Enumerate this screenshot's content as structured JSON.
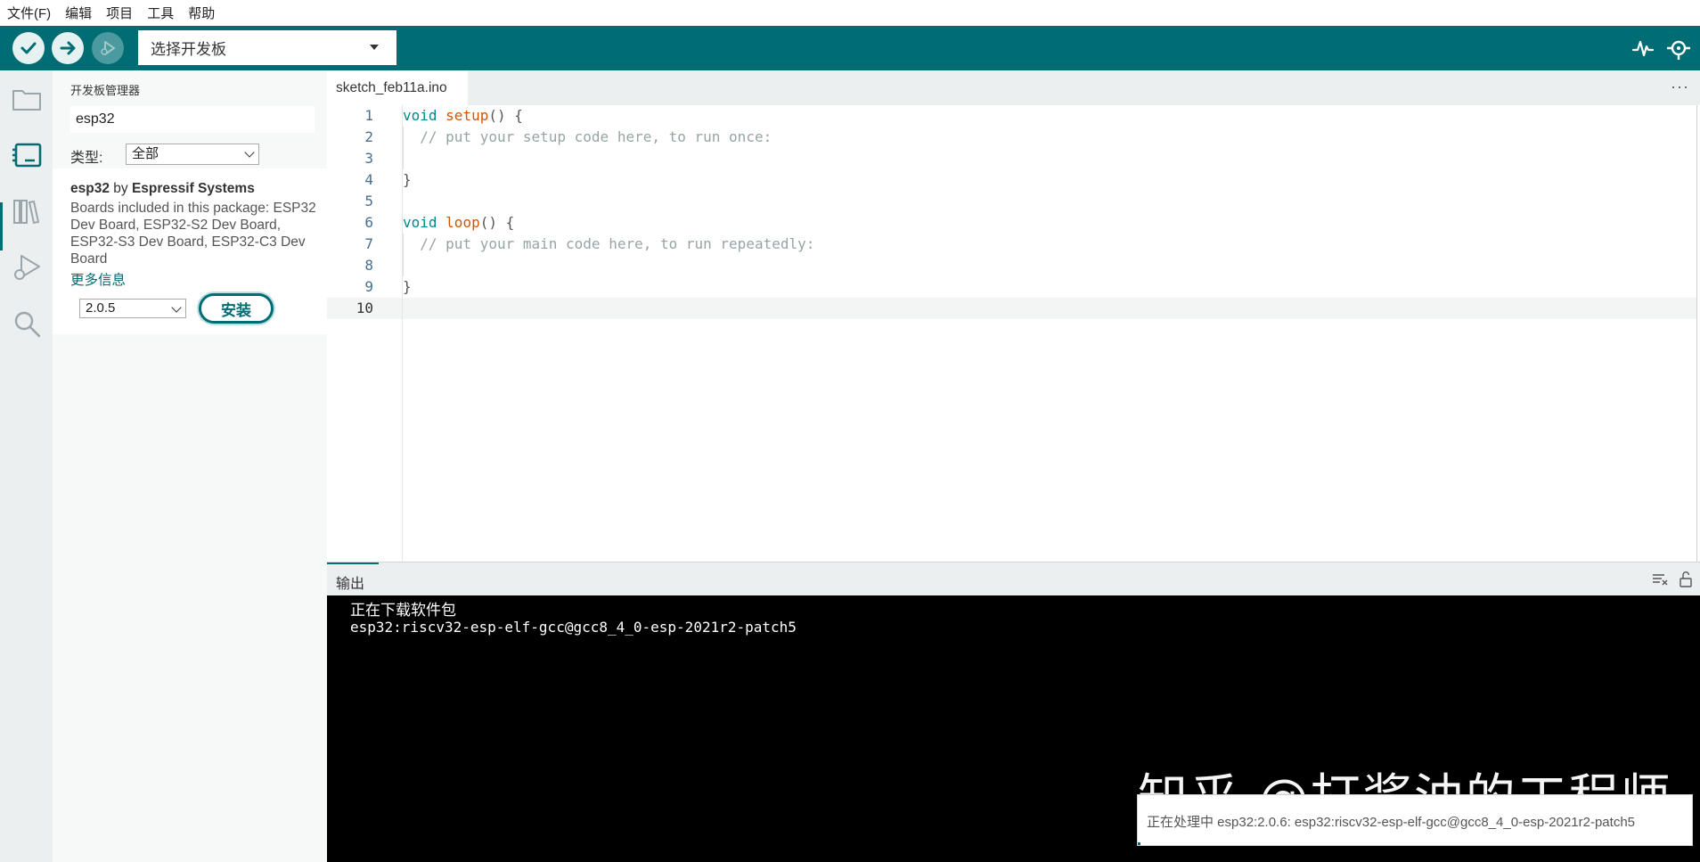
{
  "menu": [
    "文件(F)",
    "编辑",
    "项目",
    "工具",
    "帮助"
  ],
  "toolbar": {
    "board_select_label": "选择开发板"
  },
  "board_manager": {
    "title": "开发板管理器",
    "search_value": "esp32",
    "type_label": "类型:",
    "type_value": "全部",
    "package": {
      "name": "esp32",
      "by_word": "by",
      "author": "Espressif Systems",
      "description": "Boards included in this package: ESP32 Dev Board, ESP32-S2 Dev Board, ESP32-S3 Dev Board, ESP32-C3 Dev Board",
      "more_info": "更多信息",
      "version": "2.0.5",
      "install_label": "安装"
    }
  },
  "editor": {
    "tab_name": "sketch_feb11a.ino",
    "tab_more": "···",
    "current_line": 10,
    "lines": [
      {
        "n": "1",
        "tokens": [
          {
            "t": "void",
            "c": "kw"
          },
          {
            "t": " ",
            "c": ""
          },
          {
            "t": "setup",
            "c": "fn"
          },
          {
            "t": "() {",
            "c": ""
          }
        ]
      },
      {
        "n": "2",
        "tokens": [
          {
            "t": "  // put your setup code here, to run once:",
            "c": "cm"
          }
        ]
      },
      {
        "n": "3",
        "tokens": []
      },
      {
        "n": "4",
        "tokens": [
          {
            "t": "}",
            "c": ""
          }
        ]
      },
      {
        "n": "5",
        "tokens": []
      },
      {
        "n": "6",
        "tokens": [
          {
            "t": "void",
            "c": "kw"
          },
          {
            "t": " ",
            "c": ""
          },
          {
            "t": "loop",
            "c": "fn"
          },
          {
            "t": "() {",
            "c": ""
          }
        ]
      },
      {
        "n": "7",
        "tokens": [
          {
            "t": "  // put your main code here, to run repeatedly:",
            "c": "cm"
          }
        ]
      },
      {
        "n": "8",
        "tokens": []
      },
      {
        "n": "9",
        "tokens": [
          {
            "t": "}",
            "c": ""
          }
        ]
      },
      {
        "n": "10",
        "tokens": []
      }
    ]
  },
  "output": {
    "tab_label": "输出",
    "lines": [
      "正在下载软件包",
      "esp32:riscv32-esp-elf-gcc@gcc8_4_0-esp-2021r2-patch5"
    ]
  },
  "watermark": "知乎 @打酱油的工程师",
  "status": {
    "text": "正在处理中 esp32:2.0.6: esp32:riscv32-esp-elf-gcc@gcc8_4_0-esp-2021r2-patch5",
    "progress": 0.005
  },
  "colors": {
    "accent": "#006c73",
    "keyword": "#00878f",
    "function": "#d35400",
    "comment": "#95a5a6"
  }
}
